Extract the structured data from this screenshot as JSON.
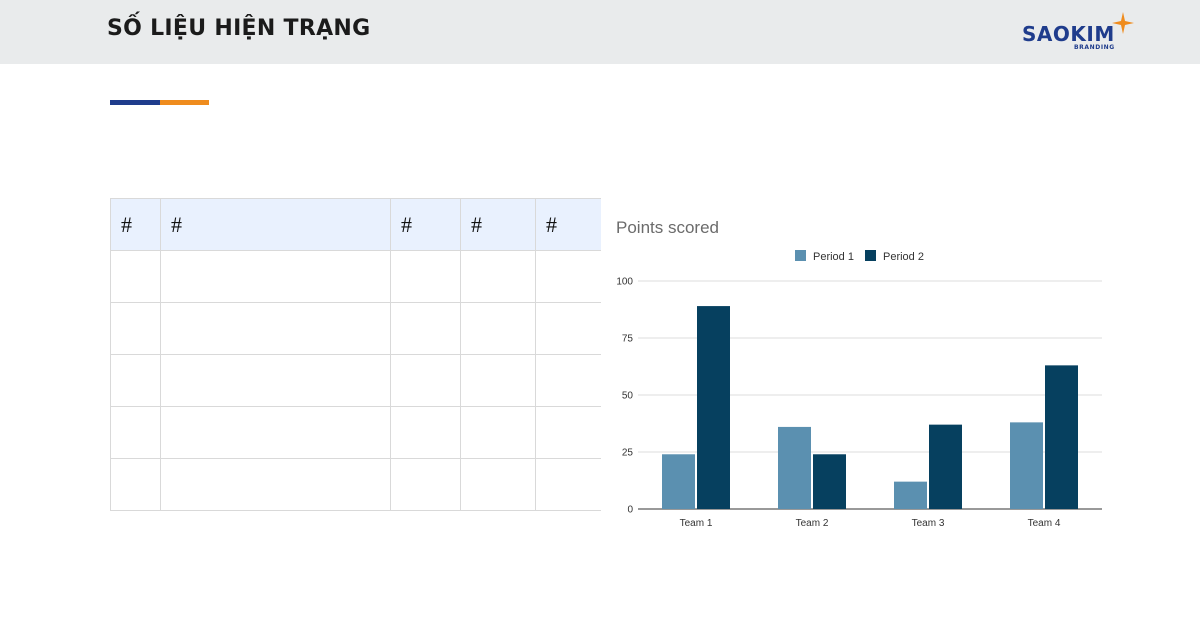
{
  "header": {
    "title": "SỐ LIỆU HIỆN TRẠNG",
    "logo": {
      "word": "SAOKIM",
      "sub": "BRANDING",
      "star_color": "#ef8c1e",
      "brand_color": "#1f3c8c"
    }
  },
  "accent": {
    "primary": "#1f3c8c",
    "secondary": "#ef8c1e"
  },
  "table": {
    "headers": [
      "#",
      "#",
      "#",
      "#",
      "#"
    ],
    "rows": [
      [
        "",
        "",
        "",
        "",
        ""
      ],
      [
        "",
        "",
        "",
        "",
        ""
      ],
      [
        "",
        "",
        "",
        "",
        ""
      ],
      [
        "",
        "",
        "",
        "",
        ""
      ],
      [
        "",
        "",
        "",
        "",
        ""
      ]
    ]
  },
  "chart_data": {
    "type": "bar",
    "title": "Points scored",
    "categories": [
      "Team 1",
      "Team 2",
      "Team 3",
      "Team 4"
    ],
    "series": [
      {
        "name": "Period 1",
        "values": [
          24,
          36,
          12,
          38
        ],
        "color": "#5b90b0"
      },
      {
        "name": "Period 2",
        "values": [
          89,
          24,
          37,
          63
        ],
        "color": "#06405f"
      }
    ],
    "yticks": [
      0,
      25,
      50,
      75,
      100
    ],
    "ylim": [
      0,
      100
    ],
    "xlabel": "",
    "ylabel": "",
    "grid": true,
    "legend_position": "top"
  }
}
